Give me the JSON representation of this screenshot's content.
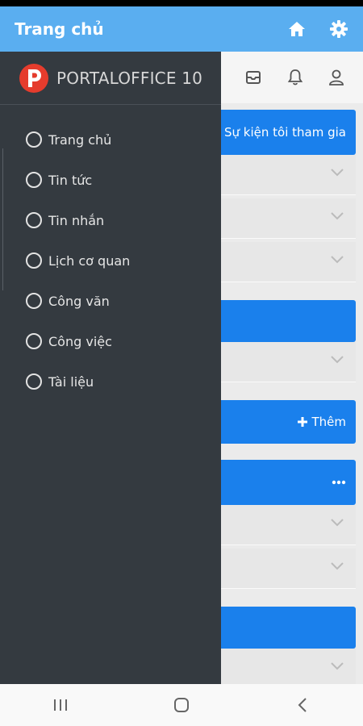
{
  "app_bar": {
    "title": "Trang chủ",
    "icons": [
      "home-icon",
      "gear-icon"
    ],
    "color": "#5aaef0"
  },
  "background_page": {
    "header_icons": [
      "mail-icon",
      "bell-icon",
      "user-icon"
    ],
    "events_bar_label": "Sự kiện tôi tham gia",
    "add_button_label": "Thêm",
    "accent_color": "#1a80ec"
  },
  "drawer": {
    "brand": "PORTALOFFICE 10",
    "logo_letter": "P",
    "items": [
      {
        "label": "Trang chủ"
      },
      {
        "label": "Tin tức"
      },
      {
        "label": "Tin nhắn"
      },
      {
        "label": "Lịch cơ quan"
      },
      {
        "label": "Công văn"
      },
      {
        "label": "Công việc"
      },
      {
        "label": "Tài liệu"
      }
    ],
    "background": "#343a40"
  },
  "nav_bar": {
    "buttons": [
      "recents-icon",
      "home-nav-icon",
      "back-icon"
    ]
  }
}
